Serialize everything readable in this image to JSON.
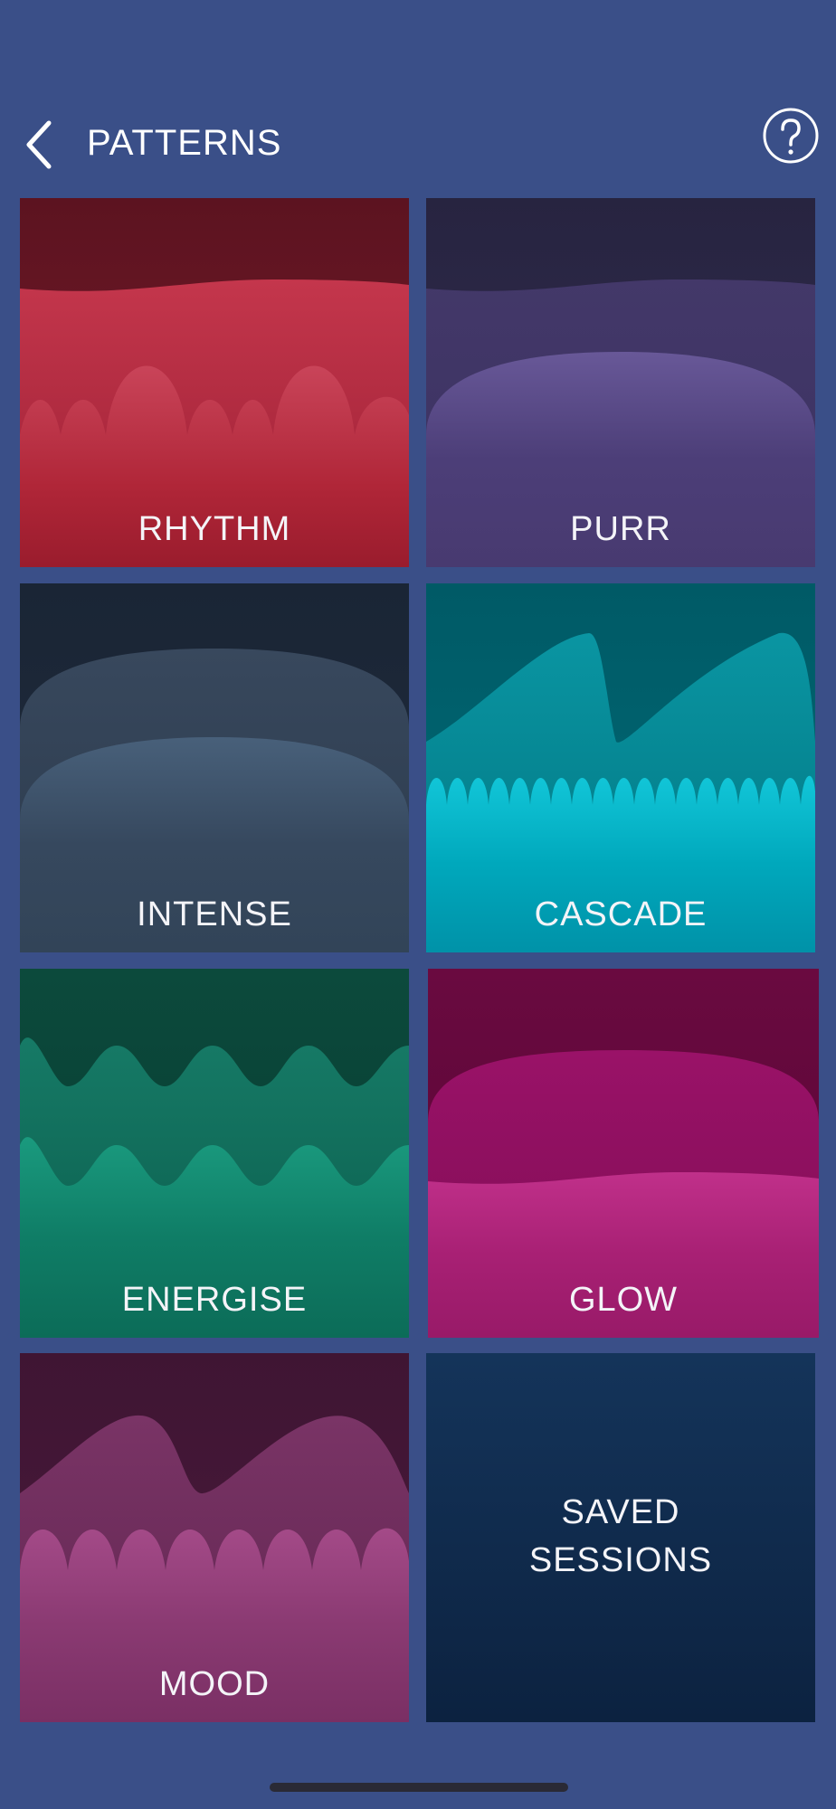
{
  "header": {
    "title": "PATTERNS"
  },
  "icons": {
    "back": "chevron-left-icon",
    "help": "question-circle-icon"
  },
  "tiles": [
    {
      "id": "rhythm",
      "label": "RHYTHM",
      "colors": {
        "top": "#6e1a2a",
        "mid": "#b82a40",
        "front": "#c0344a"
      }
    },
    {
      "id": "purr",
      "label": "PURR",
      "colors": {
        "top": "#2b2647",
        "mid": "#3e345e",
        "front": "#5a4886"
      }
    },
    {
      "id": "intense",
      "label": "INTENSE",
      "colors": {
        "top": "#1c2838",
        "mid": "#2f3e50",
        "front": "#3a4d63"
      }
    },
    {
      "id": "cascade",
      "label": "CASCADE",
      "colors": {
        "top": "#00606d",
        "mid": "#00808c",
        "front": "#00aac0"
      }
    },
    {
      "id": "energise",
      "label": "ENERGISE",
      "colors": {
        "top": "#063c32",
        "mid": "#0a5f50",
        "front": "#118a72"
      }
    },
    {
      "id": "glow",
      "label": "GLOW",
      "colors": {
        "top": "#5e0638",
        "mid": "#85105a",
        "front": "#b2267a"
      }
    },
    {
      "id": "mood",
      "label": "MOOD",
      "colors": {
        "top": "#451838",
        "mid": "#69294f",
        "front": "#924077"
      }
    },
    {
      "id": "saved-sessions",
      "label_line1": "SAVED",
      "label_line2": "SESSIONS",
      "colors": {
        "top": "#143156",
        "bottom": "#0d2340"
      }
    }
  ]
}
